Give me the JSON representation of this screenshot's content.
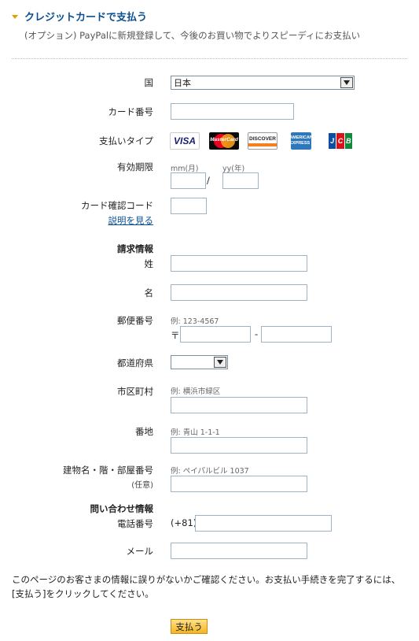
{
  "header": {
    "title": "クレジットカードで支払う",
    "subtitle": "(オプション) PayPalに新規登録して、今後のお買い物でよりスピーディにお支払い"
  },
  "form": {
    "country": {
      "label": "国",
      "value": "日本"
    },
    "card_number": {
      "label": "カード番号",
      "value": ""
    },
    "payment_type": {
      "label": "支払いタイプ",
      "cards": [
        "VISA",
        "MasterCard",
        "DISCOVER",
        "AMERICAN EXPRESS",
        "JCB"
      ]
    },
    "expiry": {
      "label": "有効期限",
      "month_hint": "mm(月)",
      "year_hint": "yy(年)",
      "separator": "/"
    },
    "cvv": {
      "label": "カード確認コード",
      "help_link": "説明を見る"
    },
    "billing": {
      "heading": "請求情報",
      "last_name": "姓",
      "first_name": "名",
      "postal": {
        "label": "郵便番号",
        "example": "例: 123-4567",
        "prefix": "〒",
        "dash": "-"
      },
      "prefecture": {
        "label": "都道府県",
        "value": ""
      },
      "city": {
        "label": "市区町村",
        "example": "例: 横浜市緑区"
      },
      "address": {
        "label": "番地",
        "example": "例: 青山 1-1-1"
      },
      "building": {
        "label": "建物名・階・部屋番号",
        "optional": "(任意)",
        "example": "例: ペイパルビル 1037"
      }
    },
    "contact": {
      "heading": "問い合わせ情報",
      "phone": {
        "label": "電話番号",
        "country_code": "(+81)"
      },
      "email": {
        "label": "メール"
      }
    }
  },
  "confirm_text": "このページのお客さまの情報に誤りがないかご確認ください。お支払い手続きを完了するには、[支払う]をクリックしてください。",
  "pay_button": "支払う",
  "colors": {
    "accent_title": "#0a4f90",
    "button": "#f4b522",
    "triangle": "#e1a000"
  }
}
